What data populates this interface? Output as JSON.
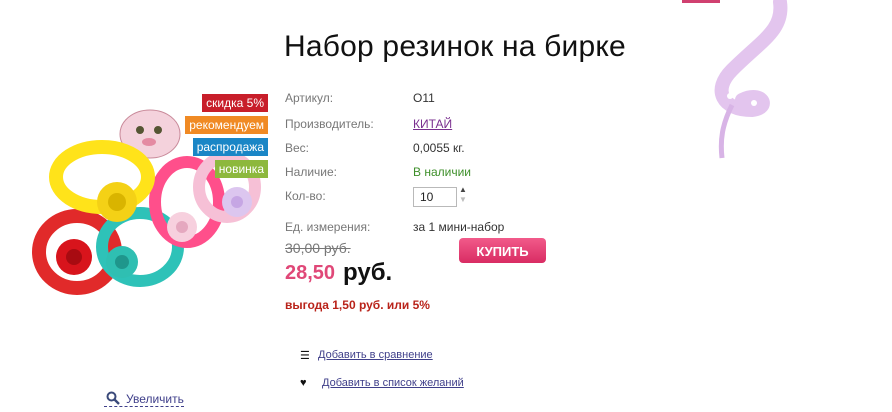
{
  "product": {
    "title": "Набор резинок на бирке"
  },
  "badges": [
    {
      "label": "скидка 5%",
      "color": "#c81e2a"
    },
    {
      "label": "рекомендуем",
      "color": "#f08a24"
    },
    {
      "label": "распродажа",
      "color": "#1a86c6"
    },
    {
      "label": "новинка",
      "color": "#8db83d"
    }
  ],
  "specs": {
    "article_label": "Артикул:",
    "article_value": "О11",
    "maker_label": "Производитель:",
    "maker_value": "КИТАЙ",
    "weight_label": "Вес:",
    "weight_value": "0,0055 кг.",
    "stock_label": "Наличие:",
    "stock_value": "В наличии",
    "qty_label": "Кол-во:",
    "qty_value": "10",
    "unit_label": "Ед. измерения:",
    "unit_value": "за 1 мини-набор"
  },
  "price": {
    "old": "30,00 руб.",
    "current": "28,50",
    "currency": "руб.",
    "saving": "выгода 1,50 руб. или 5%"
  },
  "buy_label": "КУПИТЬ",
  "actions": {
    "compare": "Добавить в сравнение",
    "wishlist": "Добавить в список желаний"
  },
  "zoom_label": "Увеличить",
  "accent": "#e04878"
}
